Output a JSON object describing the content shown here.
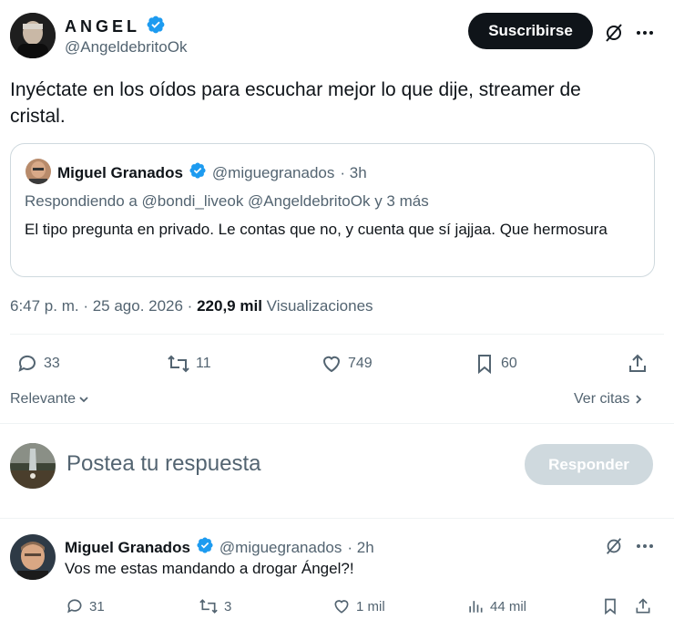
{
  "author": {
    "display_name": "ANGEL",
    "handle": "@AngeldebritoOk"
  },
  "subscribe_label": "Suscribirse",
  "tweet_text": "Inyéctate en los oídos para escuchar mejor lo que dije, streamer de cristal.",
  "quote": {
    "display_name": "Miguel Granados",
    "handle": "@miguegranados",
    "time": "· 3h",
    "replying_to": "Respondiendo a @bondi_liveok @AngeldebritoOk y 3 más",
    "text": "El tipo pregunta en privado. Le contas que no, y cuenta que sí jajjaa. Que hermosura"
  },
  "meta": {
    "timestamp": "6:47 p. m. · 25 ago. 2026 ·",
    "views_count": "220,9 mil",
    "views_label": "Visualizaciones"
  },
  "actions": {
    "replies": "33",
    "retweets": "11",
    "likes": "749",
    "bookmarks": "60"
  },
  "sort": {
    "label": "Relevante",
    "quotes_label": "Ver citas"
  },
  "compose": {
    "placeholder": "Postea tu respuesta",
    "button": "Responder"
  },
  "reply": {
    "display_name": "Miguel Granados",
    "handle": "@miguegranados",
    "time": "· 2h",
    "text": "Vos me estas mandando a drogar Ángel?!",
    "replies": "31",
    "retweets": "3",
    "likes": "1 mil",
    "views": "44 mil"
  },
  "colors": {
    "verified": "#1d9bf0",
    "text": "#0f1419",
    "muted": "#536471",
    "border": "#cfd9de"
  }
}
